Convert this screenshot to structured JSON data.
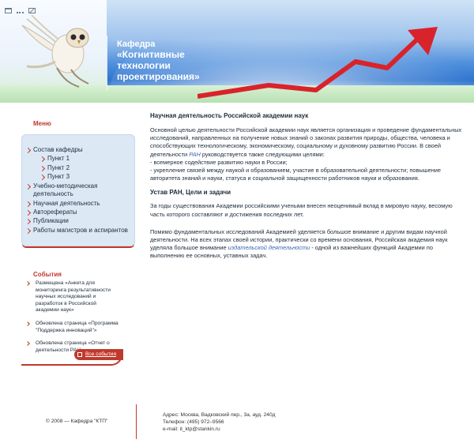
{
  "header": {
    "kafedra": "Кафедра",
    "title_lines": [
      "«Когнитивные",
      "технологии",
      "проектирования»"
    ],
    "colors": {
      "accent_red": "#d9232a",
      "sky_blue": "#3f86d8",
      "band_green": "#c4e6be"
    },
    "top_icons": [
      "home-icon",
      "sitemap-icon",
      "mail-icon"
    ]
  },
  "menu": {
    "title": "Меню",
    "items": [
      {
        "label": "Состав кафедры",
        "level": 1
      },
      {
        "label": "Пункт 1",
        "level": 2
      },
      {
        "label": "Пункт 2",
        "level": 2
      },
      {
        "label": "Пункт 3",
        "level": 2
      },
      {
        "label": "Учебно-методическая деятельность",
        "level": 1
      },
      {
        "label": "Научная деятельность",
        "level": 1
      },
      {
        "label": "Авторефераты",
        "level": 1
      },
      {
        "label": "Публикации",
        "level": 1
      },
      {
        "label": "Работы магистров и аспирантов",
        "level": 1
      }
    ]
  },
  "events": {
    "title": "События",
    "items": [
      "Размещена «Анкета для мониторинга результативности научных исследований и разработок в Российской академии наук»",
      "Обновлена страница «Программа \"Поддержка инноваций\"»",
      "Обновлена страница «Отчет о деятельности РАН»"
    ],
    "all_link": "Все события"
  },
  "main": {
    "heading": "Научная деятельность Российской академии наук",
    "p1_a": "Основной целью деятельности Российской академии наук является организация и проведение фундаментальных исследований, направленных на получение новых знаний о законах развития природы, общества, человека и способствующих технологическому, экономическому, социальному и духовному развитию России. В своей деятельности ",
    "p1_em": "РАН",
    "p1_b": " руководствуется также следующими целями:",
    "p1_c": "- всемерное содействие развитию науки в России;",
    "p1_d": "- укрепление связей между наукой и образованием, участие в образовательной деятельности; повышение авторитета знаний и науки, статуса и социальной защищенности работников науки и образования.",
    "heading2": "Устав РАН, Цели и задачи",
    "p2": "За годы существования Академии российскими учеными внесен неоценимый вклад в мировую науку, весомую часть которого составляют и достижения последних лет.",
    "p3_a": "Помимо фундаментальных исследований Академией уделяется большое внимание и другим видам научной деятельности. На всех этапах своей истории, практически со времени основания, Российская академия наук уделяла большое внимание ",
    "p3_em": "издательской деятельности",
    "p3_b": " - одной из важнейших функций Академии по выполнению ее основных, уставных задач."
  },
  "footer": {
    "copyright": "© 2008 — Кафедра \"КТП\"",
    "address": "Адрес: Москва, Вадковский пер., 3а, ауд. 240д",
    "phone": "Телефон: (495) 972–9566",
    "email": "e-mail: it_ktp@stankin.ru"
  }
}
